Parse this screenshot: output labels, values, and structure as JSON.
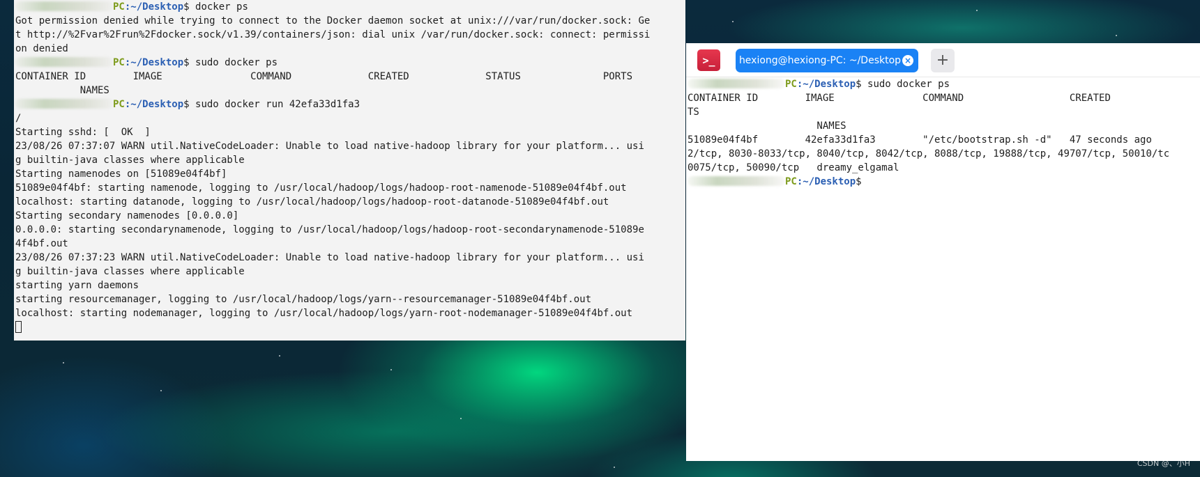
{
  "terminal_left": {
    "lines": [
      {
        "type": "prompt",
        "pc": "PC",
        "path": ":~/Desktop",
        "cmd": "$ docker ps"
      },
      {
        "type": "out",
        "text": "Got permission denied while trying to connect to the Docker daemon socket at unix:///var/run/docker.sock: Ge"
      },
      {
        "type": "out",
        "text": "t http://%2Fvar%2Frun%2Fdocker.sock/v1.39/containers/json: dial unix /var/run/docker.sock: connect: permissi"
      },
      {
        "type": "out",
        "text": "on denied"
      },
      {
        "type": "prompt",
        "pc": "PC",
        "path": ":~/Desktop",
        "cmd": "$ sudo docker ps"
      },
      {
        "type": "out",
        "text": "CONTAINER ID        IMAGE               COMMAND             CREATED             STATUS              PORTS"
      },
      {
        "type": "out",
        "text": "           NAMES"
      },
      {
        "type": "prompt",
        "pc": "PC",
        "path": ":~/Desktop",
        "cmd": "$ sudo docker run 42efa33d1fa3"
      },
      {
        "type": "out",
        "text": "/"
      },
      {
        "type": "out",
        "text": "Starting sshd: [  OK  ]"
      },
      {
        "type": "out",
        "text": "23/08/26 07:37:07 WARN util.NativeCodeLoader: Unable to load native-hadoop library for your platform... usi"
      },
      {
        "type": "out",
        "text": "g builtin-java classes where applicable"
      },
      {
        "type": "out",
        "text": "Starting namenodes on [51089e04f4bf]"
      },
      {
        "type": "out",
        "text": "51089e04f4bf: starting namenode, logging to /usr/local/hadoop/logs/hadoop-root-namenode-51089e04f4bf.out"
      },
      {
        "type": "out",
        "text": "localhost: starting datanode, logging to /usr/local/hadoop/logs/hadoop-root-datanode-51089e04f4bf.out"
      },
      {
        "type": "out",
        "text": "Starting secondary namenodes [0.0.0.0]"
      },
      {
        "type": "out",
        "text": "0.0.0.0: starting secondarynamenode, logging to /usr/local/hadoop/logs/hadoop-root-secondarynamenode-51089e"
      },
      {
        "type": "out",
        "text": "4f4bf.out"
      },
      {
        "type": "out",
        "text": "23/08/26 07:37:23 WARN util.NativeCodeLoader: Unable to load native-hadoop library for your platform... usi"
      },
      {
        "type": "out",
        "text": "g builtin-java classes where applicable"
      },
      {
        "type": "out",
        "text": "starting yarn daemons"
      },
      {
        "type": "out",
        "text": "starting resourcemanager, logging to /usr/local/hadoop/logs/yarn--resourcemanager-51089e04f4bf.out"
      },
      {
        "type": "out",
        "text": "localhost: starting nodemanager, logging to /usr/local/hadoop/logs/yarn-root-nodemanager-51089e04f4bf.out"
      },
      {
        "type": "cursor"
      }
    ]
  },
  "terminal_right": {
    "app_icon": "terminal-icon",
    "app_icon_glyph": ">_",
    "tab_label": "hexiong@hexiong-PC: ~/Desktop",
    "tab_close_glyph": "×",
    "add_tab_glyph": "+",
    "lines": [
      {
        "type": "prompt",
        "pc": "PC",
        "path": ":~/Desktop",
        "cmd": "$ sudo docker ps"
      },
      {
        "type": "out",
        "text": "CONTAINER ID        IMAGE               COMMAND                  CREATED"
      },
      {
        "type": "out",
        "text": "TS"
      },
      {
        "type": "out",
        "text": "                      NAMES"
      },
      {
        "type": "out",
        "text": "51089e04f4bf        42efa33d1fa3        \"/etc/bootstrap.sh -d\"   47 seconds ago"
      },
      {
        "type": "out",
        "text": "2/tcp, 8030-8033/tcp, 8040/tcp, 8042/tcp, 8088/tcp, 19888/tcp, 49707/tcp, 50010/tc"
      },
      {
        "type": "out",
        "text": "0075/tcp, 50090/tcp   dreamy_elgamal"
      },
      {
        "type": "prompt",
        "pc": "PC",
        "path": ":~/Desktop",
        "cmd": "$"
      }
    ]
  },
  "watermark": "CSDN @、小H",
  "colors": {
    "terminal_bg": "#f3f3f3",
    "prompt_host": "#7d9b1b",
    "prompt_path": "#2b5fb3",
    "tab_active": "#1a82f5",
    "app_icon": "#d62b45"
  }
}
